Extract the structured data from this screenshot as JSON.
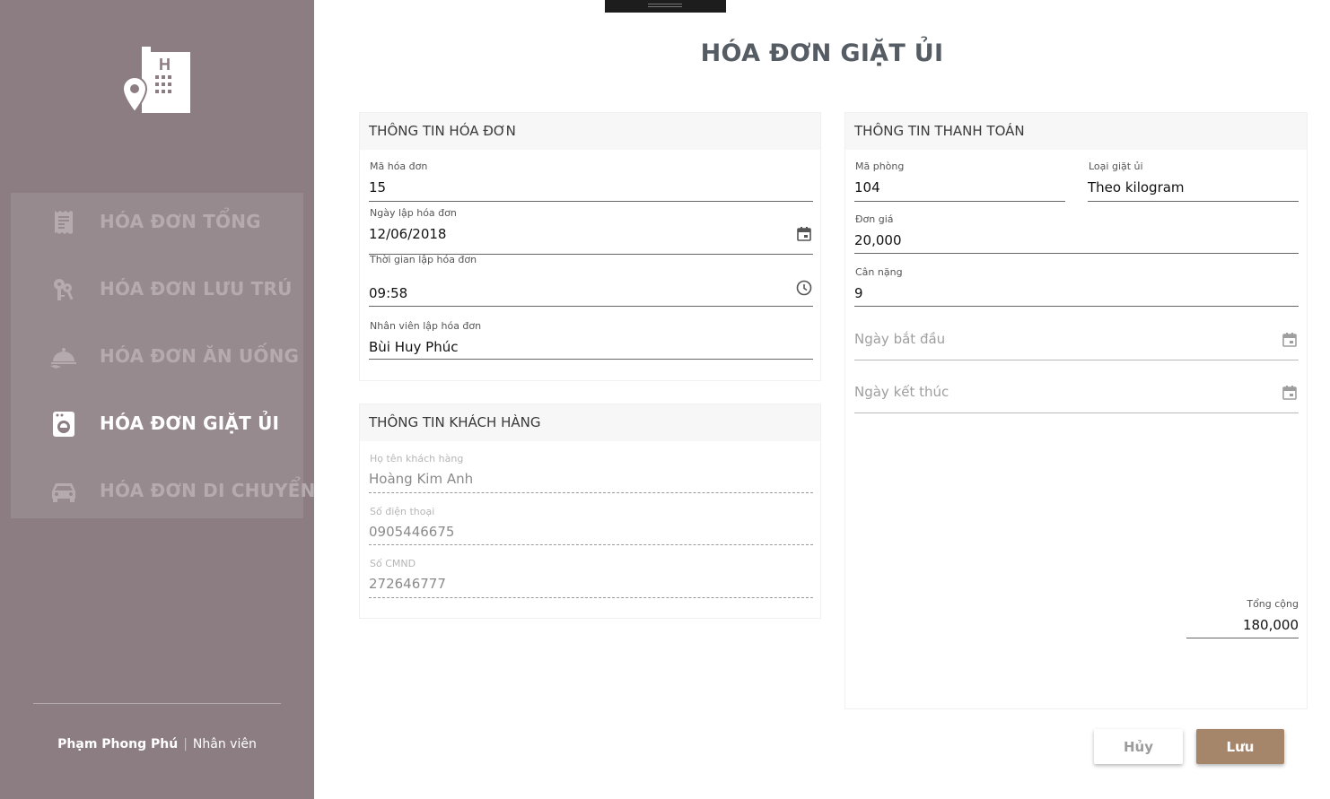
{
  "app": {
    "page_title": "HÓA ĐƠN GIẶT ỦI"
  },
  "sidebar": {
    "logo_icon": "hotel-building-pin-icon",
    "items": [
      {
        "label": "HÓA ĐƠN TỔNG",
        "icon": "receipt-icon",
        "active": false
      },
      {
        "label": "HÓA ĐƠN LƯU TRÚ",
        "icon": "keys-icon",
        "active": false
      },
      {
        "label": "HÓA ĐƠN ĂN UỐNG",
        "icon": "food-cloche-icon",
        "active": false
      },
      {
        "label": "HÓA ĐƠN GIẶT ỦI",
        "icon": "washing-machine-icon",
        "active": true
      },
      {
        "label": "HÓA ĐƠN DI CHUYỂN",
        "icon": "car-icon",
        "active": false
      }
    ],
    "user": {
      "name": "Phạm Phong Phú",
      "separator": "|",
      "role": "Nhân viên"
    }
  },
  "invoice_info": {
    "header": "THÔNG TIN HÓA ĐƠN",
    "invoice_id": {
      "label": "Mã hóa đơn",
      "value": "15"
    },
    "date": {
      "label": "Ngày lập hóa đơn",
      "value": "12/06/2018"
    },
    "time": {
      "label": "Thời gian lập hóa đơn",
      "value": "09:58"
    },
    "staff": {
      "label": "Nhân viên lập hóa đơn",
      "value": "Bùi Huy Phúc"
    }
  },
  "customer_info": {
    "header": "THÔNG TIN KHÁCH HÀNG",
    "name": {
      "label": "Họ tên khách hàng",
      "value": "Hoàng Kim Anh"
    },
    "phone": {
      "label": "Số điện thoại",
      "value": "0905446675"
    },
    "id_card": {
      "label": "Số CMND",
      "value": "272646777"
    }
  },
  "payment_info": {
    "header": "THÔNG TIN THANH TOÁN",
    "room": {
      "label": "Mã phòng",
      "value": "104"
    },
    "laundry_type": {
      "label": "Loại giặt ủi",
      "value": "Theo kilogram"
    },
    "unit_price": {
      "label": "Đơn giá",
      "value": "20,000"
    },
    "weight": {
      "label": "Cân nặng",
      "value": "9"
    },
    "start_date": {
      "placeholder": "Ngày bắt đầu"
    },
    "end_date": {
      "placeholder": "Ngày kết thúc"
    },
    "total": {
      "label": "Tổng cộng",
      "value": "180,000"
    }
  },
  "actions": {
    "cancel_label": "Hủy",
    "save_label": "Lưu"
  },
  "colors": {
    "sidebar_bg": "#8b7d81",
    "menu_bg": "#978a8e",
    "save_button": "#a6866a",
    "title_text": "#555c63"
  }
}
